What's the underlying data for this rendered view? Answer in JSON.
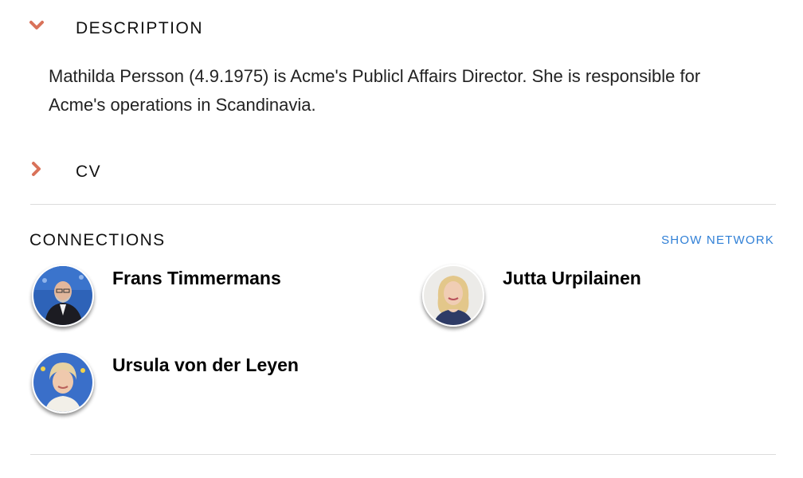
{
  "description_section": {
    "title": "DESCRIPTION",
    "expanded": true,
    "text": "Mathilda Persson (4.9.1975) is Acme's Publicl Affairs Director. She is responsible for Acme's operations in Scandinavia."
  },
  "cv_section": {
    "title": "CV",
    "expanded": false
  },
  "connections": {
    "title": "CONNECTIONS",
    "show_network_label": "SHOW NETWORK",
    "items": [
      {
        "name": "Frans Timmermans"
      },
      {
        "name": "Jutta Urpilainen"
      },
      {
        "name": "Ursula von der Leyen"
      }
    ]
  },
  "colors": {
    "chevron": "#d9725a",
    "link": "#2f7fd6",
    "divider": "#dcdcdc"
  },
  "icons": {
    "expanded": "chevron-down-icon",
    "collapsed": "chevron-right-icon"
  }
}
